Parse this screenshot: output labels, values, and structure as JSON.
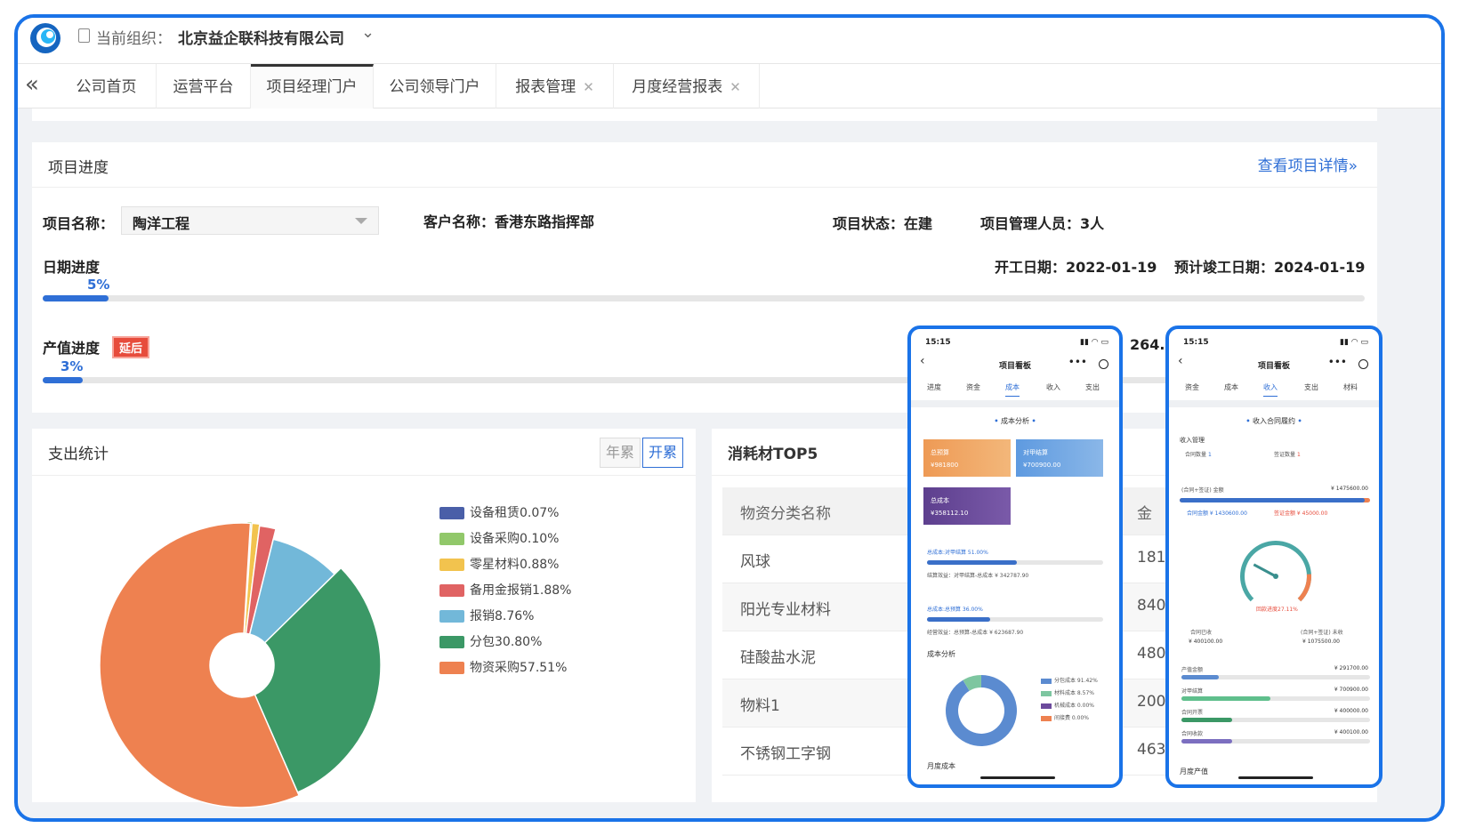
{
  "header": {
    "org_label": "当前组织：",
    "org_name": "北京益企联科技有限公司"
  },
  "tabs": [
    {
      "label": "公司首页"
    },
    {
      "label": "运营平台"
    },
    {
      "label": "项目经理门户",
      "active": true
    },
    {
      "label": "公司领导门户"
    },
    {
      "label": "报表管理",
      "closable": true
    },
    {
      "label": "月度经营报表",
      "closable": true
    }
  ],
  "progress": {
    "title": "项目进度",
    "detail_link": "查看项目详情»",
    "project_label": "项目名称：",
    "project_value": "陶洋工程",
    "customer": "客户名称：香港东路指挥部",
    "status": "项目状态：在建",
    "managers": "项目管理人员：3人",
    "date_label": "日期进度",
    "date_pct": "5%",
    "start": "开工日期：2022-01-19",
    "end": "预计竣工日期：2024-01-19",
    "output_label": "产值进度",
    "output_tag": "延后",
    "output_pct": "3%",
    "output_amount": "264."
  },
  "expense": {
    "title": "支出统计",
    "toggle_year": "年累",
    "toggle_all": "开累"
  },
  "chart_data": {
    "type": "pie",
    "series": [
      {
        "name": "设备租赁",
        "value": 0.07,
        "label": "设备租赁0.07%",
        "color": "#4a5fa8"
      },
      {
        "name": "设备采购",
        "value": 0.1,
        "label": "设备采购0.10%",
        "color": "#91c86a"
      },
      {
        "name": "零星材料",
        "value": 0.88,
        "label": "零星材料0.88%",
        "color": "#f2c34e"
      },
      {
        "name": "备用金报销",
        "value": 1.88,
        "label": "备用金报销1.88%",
        "color": "#e06363"
      },
      {
        "name": "报销",
        "value": 8.76,
        "label": "报销8.76%",
        "color": "#72b8d9"
      },
      {
        "name": "分包",
        "value": 30.8,
        "label": "分包30.80%",
        "color": "#3b9866"
      },
      {
        "name": "物资采购",
        "value": 57.51,
        "label": "物资采购57.51%",
        "color": "#ee8150"
      }
    ],
    "donut": true,
    "legend": "right"
  },
  "top5": {
    "title": "消耗材TOP5",
    "col1": "物资分类名称",
    "col2": "金",
    "rows": [
      {
        "name": "风球",
        "val": "1815"
      },
      {
        "name": "阳光专业材料",
        "val": "840"
      },
      {
        "name": "硅酸盐水泥",
        "val": "480"
      },
      {
        "name": "物料1",
        "val": "200"
      },
      {
        "name": "不锈钢工字钢",
        "val": "463"
      }
    ]
  },
  "phone1": {
    "time": "15:15",
    "title": "项目看板",
    "tabs": [
      "进度",
      "资金",
      "成本",
      "收入",
      "支出"
    ],
    "section": "成本分析",
    "cards": [
      {
        "label": "总预算",
        "value": "¥981800",
        "color": "#ee9a55"
      },
      {
        "label": "对甲结算",
        "value": "¥700900.00",
        "color": "#6aa6e0"
      },
      {
        "label": "总成本",
        "value": "¥358112.10",
        "color": "#6c4a9c"
      }
    ],
    "ratio1": "总成本:对甲结算 51.00%",
    "ratio1_note": "结算效益：对甲结算-总成本 ¥ 342787.90",
    "ratio2": "总成本:总预算 36.00%",
    "ratio2_note": "经营效益：总预算-总成本 ¥ 623687.90",
    "cost_analysis": "成本分析",
    "legend": [
      {
        "label": "分包成本 91.42%",
        "color": "#5b8bd0",
        "value": 91.42
      },
      {
        "label": "材料成本 8.57%",
        "color": "#7dc6a0",
        "value": 8.57
      },
      {
        "label": "机械成本 0.00%",
        "color": "#6c4a9c",
        "value": 0
      },
      {
        "label": "间接费 0.00%",
        "color": "#ee8150",
        "value": 0
      }
    ],
    "monthly": "月度成本"
  },
  "phone2": {
    "time": "15:15",
    "title": "项目看板",
    "tabs": [
      "资金",
      "成本",
      "收入",
      "支出",
      "材料"
    ],
    "section": "收入合同履约",
    "mgmt": "收入管理",
    "contract_count": "合同数量",
    "contract_count_val": "1",
    "visa_count": "签证数量",
    "visa_count_val": "1",
    "total_label": "(合同+签证) 金额",
    "total_val": "¥ 1475600.00",
    "contract_amt": "合同金额 ¥ 1430600.00",
    "visa_amt": "签证金额 ¥ 45000.00",
    "gauge_label": "回款进度27.11%",
    "gauge_value": 27.11,
    "received": "合同已收",
    "received_val": "¥ 400100.00",
    "unreceived": "(合同+签证) 未收",
    "unreceived_val": "¥ 1075500.00",
    "bars": [
      {
        "label": "产值金额",
        "value": "¥ 291700.00",
        "color": "#5b8bd0",
        "ratio": 0.2
      },
      {
        "label": "对甲结算",
        "value": "¥ 700900.00",
        "color": "#5fbf8c",
        "ratio": 0.47
      },
      {
        "label": "合同开票",
        "value": "¥ 400000.00",
        "color": "#3b9866",
        "ratio": 0.27
      },
      {
        "label": "合同收款",
        "value": "¥ 400100.00",
        "color": "#7c6fc0",
        "ratio": 0.27
      }
    ],
    "monthly": "月度产值"
  }
}
